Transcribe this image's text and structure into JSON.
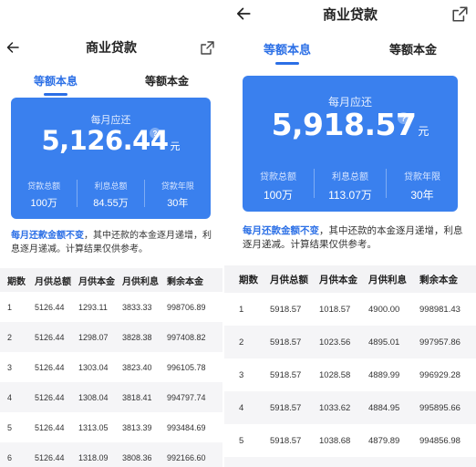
{
  "left": {
    "title": "商业贷款",
    "tabs": [
      {
        "label": "等额本息",
        "active": true
      },
      {
        "label": "等额本金",
        "active": false
      }
    ],
    "card": {
      "monthly_label": "每月应还",
      "monthly_amount": "5,126.44",
      "unit": "元",
      "help": "?",
      "stats": [
        {
          "label": "贷款总额",
          "value": "100万"
        },
        {
          "label": "利息总额",
          "value": "84.55万"
        },
        {
          "label": "贷款年限",
          "value": "30年"
        }
      ]
    },
    "notice": {
      "highlight": "每月还款金额不变",
      "text": "，其中还款的本金逐月递增，利息逐月递减。计算结果仅供参考。"
    },
    "table": {
      "headers": [
        "期数",
        "月供总额",
        "月供本金",
        "月供利息",
        "剩余本金"
      ],
      "rows": [
        [
          "1",
          "5126.44",
          "1293.11",
          "3833.33",
          "998706.89"
        ],
        [
          "2",
          "5126.44",
          "1298.07",
          "3828.38",
          "997408.82"
        ],
        [
          "3",
          "5126.44",
          "1303.04",
          "3823.40",
          "996105.78"
        ],
        [
          "4",
          "5126.44",
          "1308.04",
          "3818.41",
          "994797.74"
        ],
        [
          "5",
          "5126.44",
          "1313.05",
          "3813.39",
          "993484.69"
        ],
        [
          "6",
          "5126.44",
          "1318.09",
          "3808.36",
          "992166.60"
        ]
      ]
    }
  },
  "right": {
    "title": "商业贷款",
    "tabs": [
      {
        "label": "等额本息",
        "active": true
      },
      {
        "label": "等额本金",
        "active": false
      }
    ],
    "card": {
      "monthly_label": "每月应还",
      "monthly_amount": "5,918.57",
      "unit": "元",
      "help": "?",
      "stats": [
        {
          "label": "贷款总额",
          "value": "100万"
        },
        {
          "label": "利息总额",
          "value": "113.07万"
        },
        {
          "label": "贷款年限",
          "value": "30年"
        }
      ]
    },
    "notice": {
      "highlight": "每月还款金额不变",
      "text": "，其中还款的本金逐月递增，利息逐月递减。计算结果仅供参考。"
    },
    "table": {
      "headers": [
        "期数",
        "月供总额",
        "月供本金",
        "月供利息",
        "剩余本金"
      ],
      "rows": [
        [
          "1",
          "5918.57",
          "1018.57",
          "4900.00",
          "998981.43"
        ],
        [
          "2",
          "5918.57",
          "1023.56",
          "4895.01",
          "997957.86"
        ],
        [
          "3",
          "5918.57",
          "1028.58",
          "4889.99",
          "996929.28"
        ],
        [
          "4",
          "5918.57",
          "1033.62",
          "4884.95",
          "995895.66"
        ],
        [
          "5",
          "5918.57",
          "1038.68",
          "4879.89",
          "994856.98"
        ]
      ]
    }
  },
  "colors": {
    "accent": "#2b6fe6",
    "card": "#3a80ee",
    "row_alt": "#f5f5f7",
    "header_bg": "#f3f3f5"
  },
  "icons": {
    "back": "arrow-left-icon",
    "share": "external-link-icon"
  }
}
